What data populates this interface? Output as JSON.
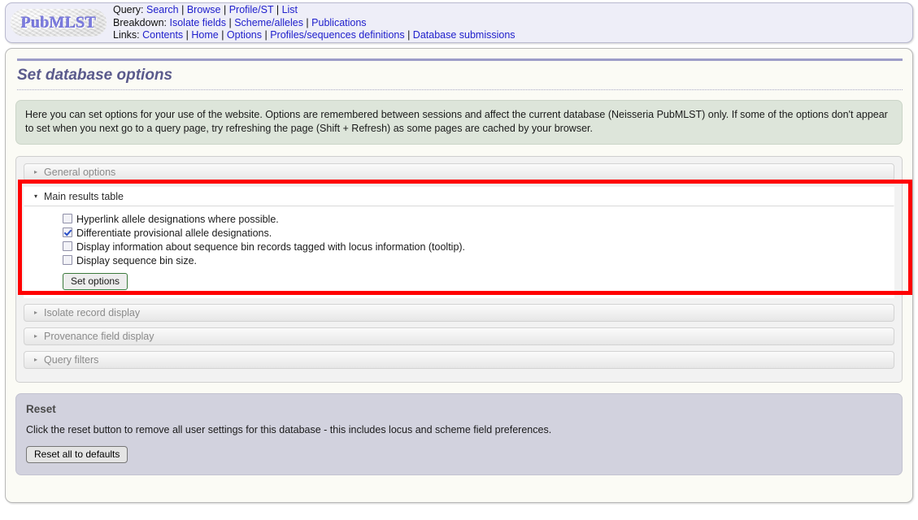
{
  "header": {
    "logo_text": "PubMLST",
    "rows": [
      {
        "label": "Query:",
        "links": [
          "Search",
          "Browse",
          "Profile/ST",
          "List"
        ]
      },
      {
        "label": "Breakdown:",
        "links": [
          "Isolate fields",
          "Scheme/alleles",
          "Publications"
        ]
      },
      {
        "label": "Links:",
        "links": [
          "Contents",
          "Home",
          "Options",
          "Profiles/sequences definitions",
          "Database submissions"
        ]
      }
    ]
  },
  "page": {
    "title": "Set database options",
    "intro": "Here you can set options for your use of the website. Options are remembered between sessions and affect the current database (Neisseria PubMLST) only. If some of the options don't appear to set when you next go to a query page, try refreshing the page (Shift + Refresh) as some pages are cached by your browser."
  },
  "accordion": {
    "sections": [
      {
        "label": "General options",
        "open": false,
        "arrow": "▸"
      },
      {
        "label": "Main results table",
        "open": true,
        "arrow": "▾"
      },
      {
        "label": "Isolate record display",
        "open": false,
        "arrow": "▸"
      },
      {
        "label": "Provenance field display",
        "open": false,
        "arrow": "▸"
      },
      {
        "label": "Query filters",
        "open": false,
        "arrow": "▸"
      }
    ]
  },
  "main_results_table": {
    "options": [
      {
        "label": "Hyperlink allele designations where possible.",
        "checked": false
      },
      {
        "label": "Differentiate provisional allele designations.",
        "checked": true
      },
      {
        "label": "Display information about sequence bin records tagged with locus information (tooltip).",
        "checked": false
      },
      {
        "label": "Display sequence bin size.",
        "checked": false
      }
    ],
    "submit_label": "Set options"
  },
  "reset": {
    "title": "Reset",
    "description": "Click the reset button to remove all user settings for this database - this includes locus and scheme field preferences.",
    "button_label": "Reset all to defaults"
  },
  "colors": {
    "highlight": "#ff0000",
    "header_bg": "#eeeef8",
    "info_bg": "#dde5da",
    "reset_bg": "#d2d2de",
    "title": "#5a5a8c",
    "link": "#2020cc"
  }
}
